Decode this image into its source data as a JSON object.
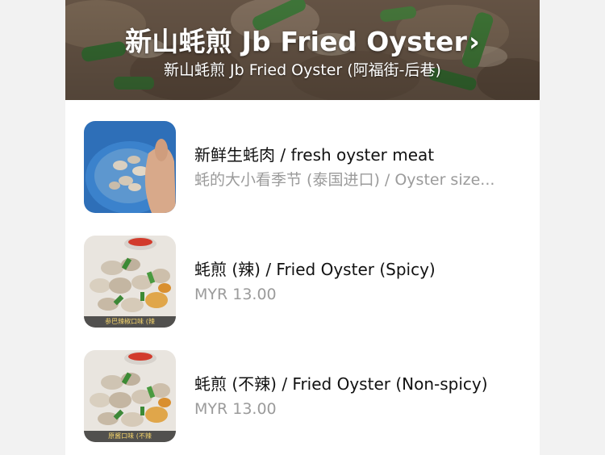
{
  "store": {
    "title": "新山蚝煎 Jb Fried Oyster",
    "title_chevron": "›",
    "subtitle": "新山蚝煎 Jb Fried Oyster (阿福街-后巷)"
  },
  "menu_items": [
    {
      "name": "新鲜生蚝肉 / fresh oyster meat",
      "subtitle": "蚝的大小看季节 (泰国进口) / Oyster size...",
      "thumb_icon": "oyster-meat-photo"
    },
    {
      "name": "蚝煎 (辣) / Fried Oyster (Spicy)",
      "subtitle": "MYR 13.00",
      "thumb_icon": "fried-oyster-photo",
      "thumb_caption": "参巴辣椒口味 (辣"
    },
    {
      "name": "蚝煎 (不辣) / Fried Oyster (Non-spicy)",
      "subtitle": "MYR 13.00",
      "thumb_icon": "fried-oyster-photo",
      "thumb_caption": "原酱口味 (不辣"
    }
  ],
  "colors": {
    "title_text": "#ffffff",
    "item_name": "#111111",
    "item_sub": "#9b9b9b",
    "background": "#f2f2f2"
  }
}
